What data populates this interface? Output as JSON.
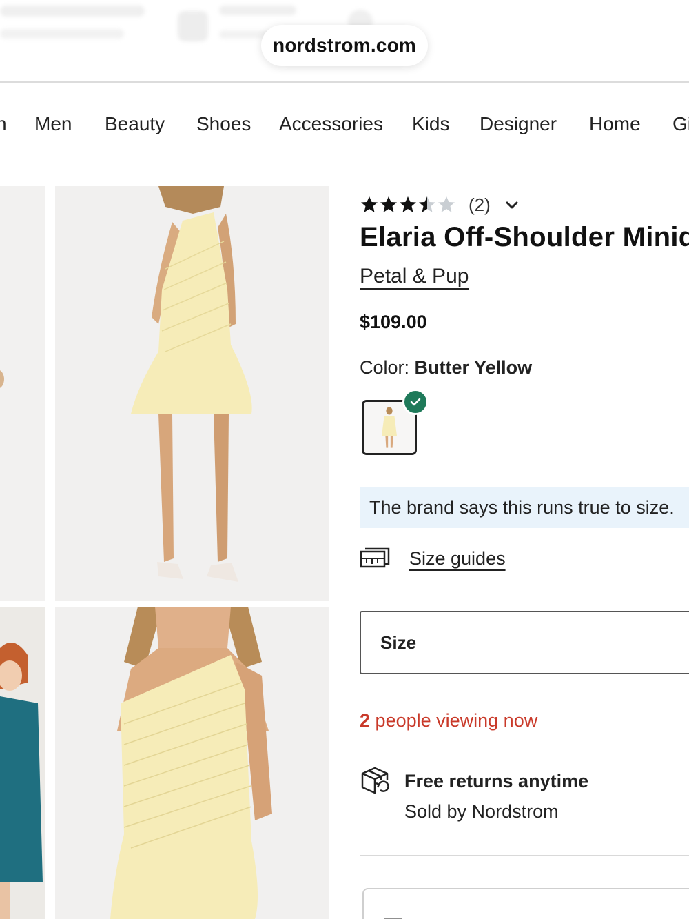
{
  "browser": {
    "url": "nordstrom.com"
  },
  "nav": {
    "items": [
      "Men",
      "Beauty",
      "Shoes",
      "Accessories",
      "Kids",
      "Designer",
      "Home"
    ]
  },
  "product": {
    "rating": 3.5,
    "rating_count": "(2)",
    "title": "Elaria Off-Shoulder Minid",
    "brand": "Petal & Pup",
    "price": "$109.00",
    "color_label": "Color:",
    "color_value": "Butter Yellow",
    "fit_note": "The brand says this runs true to size.",
    "size_guides": "Size guides",
    "size_label": "Size",
    "viewing_count": "2",
    "viewing_text": "people viewing now",
    "returns_title": "Free returns anytime",
    "returns_sub": "Sold by Nordstrom"
  },
  "colors": {
    "check_badge": "#1f7a5a",
    "viewing_text": "#c93a2a",
    "fit_banner": "#e9f3fb",
    "dress_yellow": "#f6ecb8"
  },
  "icons": [
    "star-icon",
    "chevron-down-icon",
    "check-icon",
    "ruler-icon",
    "return-box-icon"
  ]
}
